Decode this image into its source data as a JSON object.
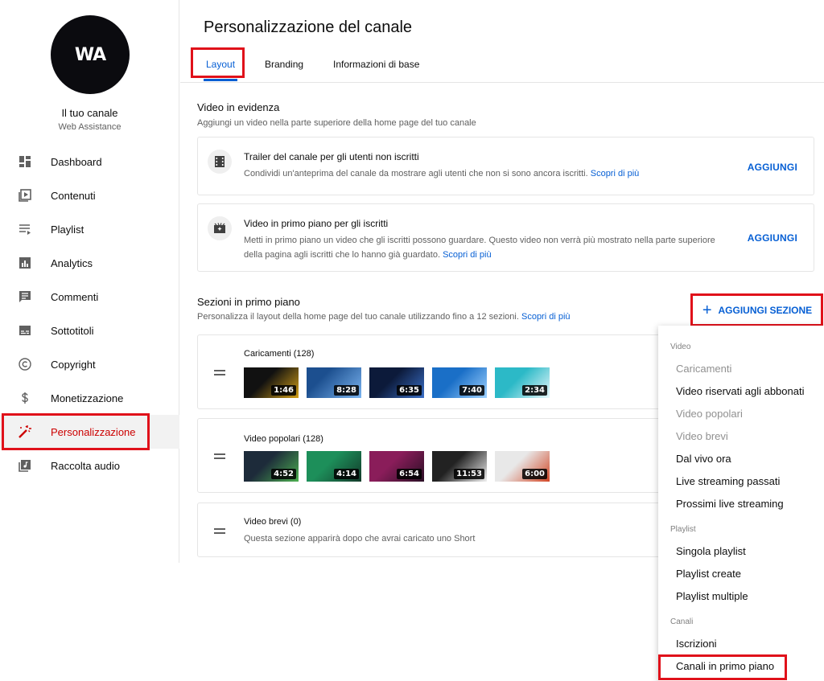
{
  "sidebar": {
    "avatar_text": "WA",
    "channel_name": "Il tuo canale",
    "channel_sub": "Web Assistance",
    "items": [
      {
        "label": "Dashboard",
        "icon": "dashboard-icon"
      },
      {
        "label": "Contenuti",
        "icon": "content-icon"
      },
      {
        "label": "Playlist",
        "icon": "playlist-icon"
      },
      {
        "label": "Analytics",
        "icon": "analytics-icon"
      },
      {
        "label": "Commenti",
        "icon": "comments-icon"
      },
      {
        "label": "Sottotitoli",
        "icon": "subtitles-icon"
      },
      {
        "label": "Copyright",
        "icon": "copyright-icon"
      },
      {
        "label": "Monetizzazione",
        "icon": "dollar-icon"
      },
      {
        "label": "Personalizzazione",
        "icon": "magic-wand-icon",
        "active": true
      },
      {
        "label": "Raccolta audio",
        "icon": "audio-library-icon"
      }
    ]
  },
  "header": {
    "title": "Personalizzazione del canale",
    "tabs": [
      {
        "label": "Layout",
        "active": true
      },
      {
        "label": "Branding"
      },
      {
        "label": "Informazioni di base"
      }
    ]
  },
  "featured": {
    "title": "Video in evidenza",
    "desc": "Aggiungi un video nella parte superiore della home page del tuo canale",
    "cards": [
      {
        "title": "Trailer del canale per gli utenti non iscritti",
        "desc": "Condividi un'anteprima del canale da mostrare agli utenti che non si sono ancora iscritti.",
        "link": "Scopri di più",
        "button": "AGGIUNGI",
        "icon": "film-icon"
      },
      {
        "title": "Video in primo piano per gli iscritti",
        "desc": "Metti in primo piano un video che gli iscritti possono guardare. Questo video non verrà più mostrato nella parte superiore della pagina agli iscritti che lo hanno già guardato.",
        "link": "Scopri di più",
        "button": "AGGIUNGI",
        "icon": "video-spark-icon"
      }
    ]
  },
  "sections": {
    "title": "Sezioni in primo piano",
    "desc": "Personalizza il layout della home page del tuo canale utilizzando fino a 12 sezioni.",
    "link": "Scopri di più",
    "add_button": "AGGIUNGI SEZIONE",
    "rows": [
      {
        "title": "Caricamenti",
        "count": "(128)",
        "thumbs": [
          {
            "duration": "1:46",
            "bg": "#1b1b1b"
          },
          {
            "duration": "8:28",
            "bg": "#1c4f8f"
          },
          {
            "duration": "6:35",
            "bg": "#0c1a3a"
          },
          {
            "duration": "7:40",
            "bg": "#1a6fc7"
          },
          {
            "duration": "2:34",
            "bg": "#2cb9c7"
          }
        ]
      },
      {
        "title": "Video popolari",
        "count": "(128)",
        "thumbs": [
          {
            "duration": "4:52",
            "bg": "#1d2b3a"
          },
          {
            "duration": "4:14",
            "bg": "#1d8f5a"
          },
          {
            "duration": "6:54",
            "bg": "#8a1d5a"
          },
          {
            "duration": "11:53",
            "bg": "#222222"
          },
          {
            "duration": "6:00",
            "bg": "#e8e8e8"
          }
        ]
      },
      {
        "title": "Video brevi",
        "count": "(0)",
        "desc": "Questa sezione apparirà dopo che avrai caricato uno Short"
      }
    ]
  },
  "menu": {
    "groups": [
      {
        "label": "Video",
        "items": [
          {
            "label": "Caricamenti",
            "disabled": true
          },
          {
            "label": "Video riservati agli abbonati"
          },
          {
            "label": "Video popolari",
            "disabled": true
          },
          {
            "label": "Video brevi",
            "disabled": true
          },
          {
            "label": "Dal vivo ora"
          },
          {
            "label": "Live streaming passati"
          },
          {
            "label": "Prossimi live streaming"
          }
        ]
      },
      {
        "label": "Playlist",
        "items": [
          {
            "label": "Singola playlist"
          },
          {
            "label": "Playlist create"
          },
          {
            "label": "Playlist multiple"
          }
        ]
      },
      {
        "label": "Canali",
        "items": [
          {
            "label": "Iscrizioni"
          },
          {
            "label": "Canali in primo piano",
            "highlighted": true
          }
        ]
      }
    ]
  },
  "colors": {
    "accent": "#065fd4",
    "active_red": "#cc0000",
    "highlight_box": "#e0111a"
  }
}
